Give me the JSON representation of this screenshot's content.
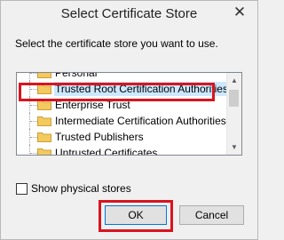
{
  "window": {
    "title": "Select Certificate Store",
    "close_glyph": "✕"
  },
  "dialog": {
    "prompt": "Select the certificate store you want to use."
  },
  "stores": [
    {
      "label": "Personal",
      "selected": false
    },
    {
      "label": "Trusted Root Certification Authorities",
      "selected": true
    },
    {
      "label": "Enterprise Trust",
      "selected": false
    },
    {
      "label": "Intermediate Certification Authorities",
      "selected": false
    },
    {
      "label": "Trusted Publishers",
      "selected": false
    },
    {
      "label": "Untrusted Certificates",
      "selected": false
    }
  ],
  "scrollbar": {
    "up_glyph": "▲",
    "down_glyph": "▼"
  },
  "options": {
    "show_physical_label": "Show physical stores",
    "show_physical_checked": false
  },
  "buttons": {
    "ok_label": "OK",
    "cancel_label": "Cancel"
  },
  "colors": {
    "highlight": "#d9141f",
    "selection": "#cce8ff",
    "folder": "#f4c95d"
  }
}
